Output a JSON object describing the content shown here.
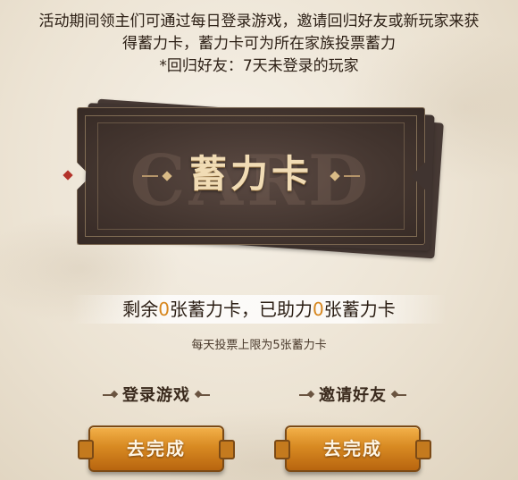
{
  "intro": {
    "line1": "活动期间领主们可通过每日登录游戏，邀请回归好友或新玩家来获",
    "line2": "得蓄力卡，蓄力卡可为所在家族投票蓄力",
    "line3": "*回归好友：7天未登录的玩家"
  },
  "card": {
    "watermark": "CARD",
    "title": "蓄力卡"
  },
  "counter": {
    "prefix": "剩余",
    "remaining": "0",
    "middle": "张蓄力卡，已助力",
    "helped": "0",
    "suffix": "张蓄力卡",
    "number_color": "#d7861d"
  },
  "limit_text": "每天投票上限为5张蓄力卡",
  "tasks": [
    {
      "title": "登录游戏",
      "button_label": "去完成"
    },
    {
      "title": "邀请好友",
      "button_label": "去完成"
    }
  ],
  "colors": {
    "background": "#ece3d3",
    "card": "#43352f",
    "button": "#d88a22"
  }
}
